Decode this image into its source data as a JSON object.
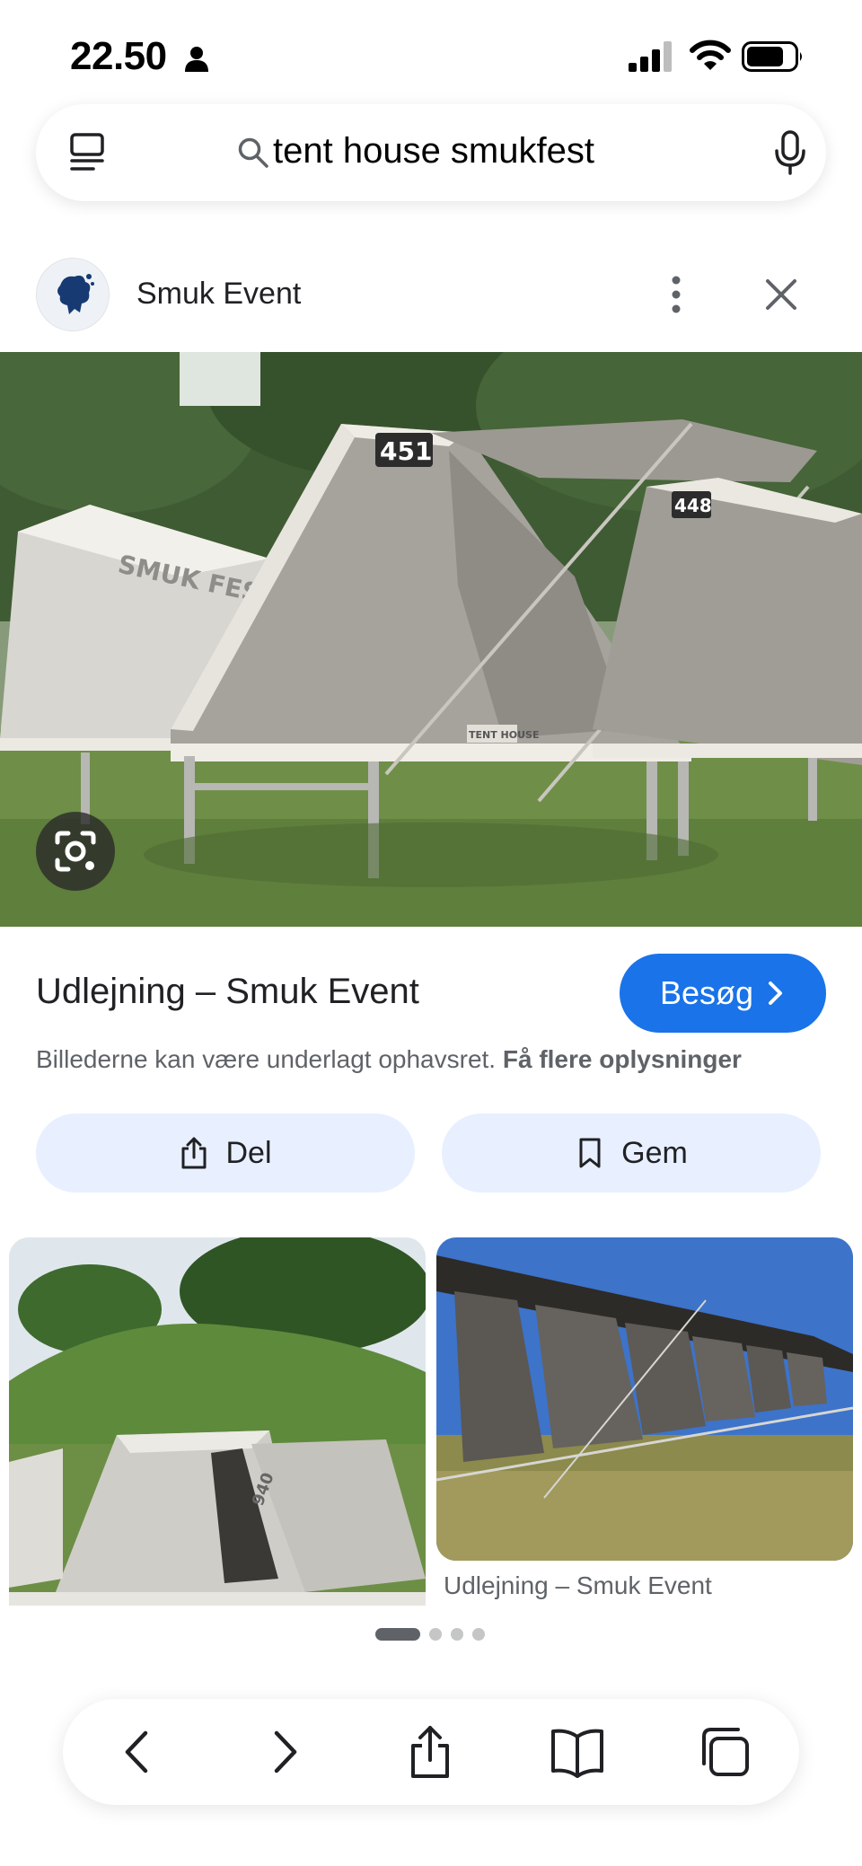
{
  "status_bar": {
    "time": "22.50",
    "icons": [
      "person-icon",
      "signal-icon",
      "wifi-icon",
      "battery-icon"
    ]
  },
  "search": {
    "query": "tent house smukfest",
    "icons": [
      "tabs-list-icon",
      "search-icon",
      "mic-icon"
    ]
  },
  "source": {
    "name": "Smuk Event",
    "icons": [
      "more-vertical-icon",
      "close-icon"
    ]
  },
  "main_image": {
    "tent_numbers": [
      "451",
      "448"
    ],
    "tent_logo_text": "SMUK FEST",
    "tent_badge": "TENT HOUSE"
  },
  "result": {
    "title": "Udlejning – Smuk Event",
    "visit_label": "Besøg",
    "copyright_text": "Billederne kan være underlagt ophavsret.",
    "copyright_link": "Få flere oplysninger"
  },
  "actions": {
    "share_label": "Del",
    "save_label": "Gem"
  },
  "related": {
    "left_tent_number": "940",
    "right_caption": "Udlejning – Smuk Event"
  },
  "pager": {
    "count": 4,
    "active_index": 0
  },
  "toolbar": {
    "icons": [
      "back-icon",
      "forward-icon",
      "share-icon",
      "bookmarks-icon",
      "tabs-icon"
    ]
  },
  "colors": {
    "accent": "#1a73e8",
    "chip_bg": "#e8efff",
    "muted_text": "#5f6368"
  }
}
